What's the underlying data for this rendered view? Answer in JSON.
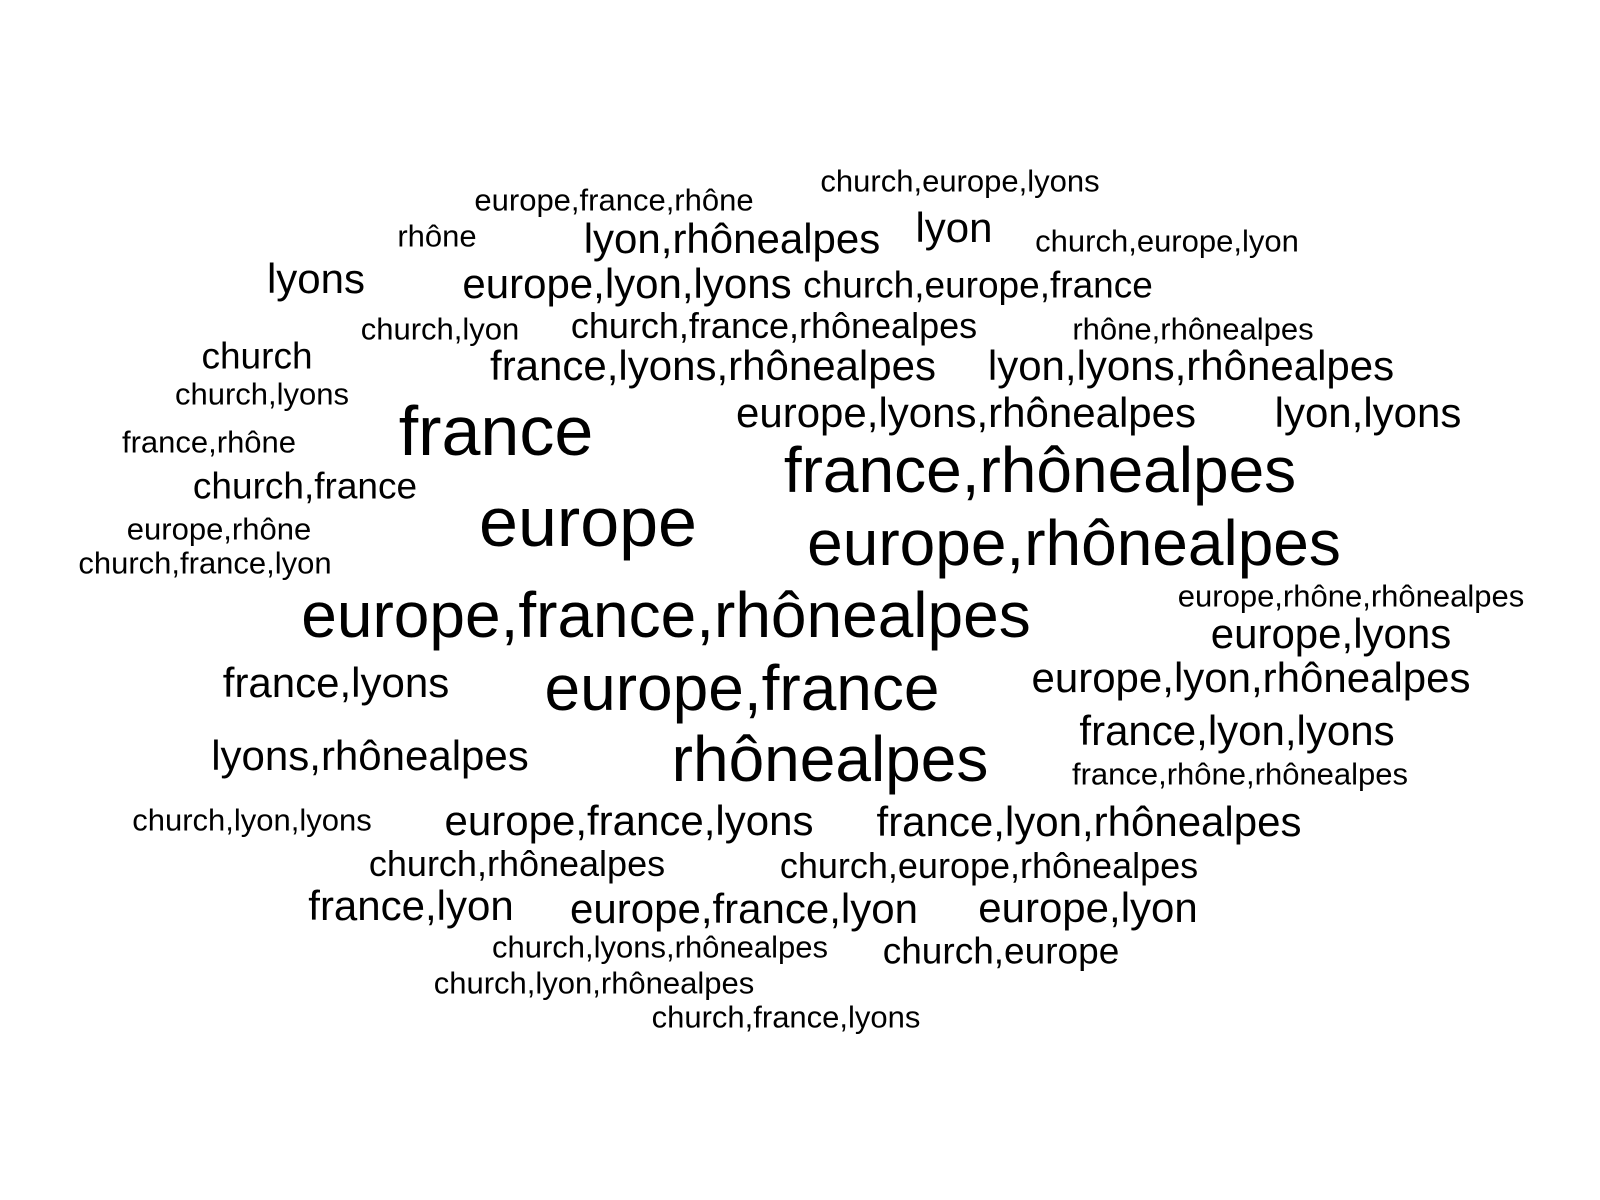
{
  "words": [
    {
      "text": "church,europe,lyons",
      "weight": 1
    },
    {
      "text": "europe,france,rhône",
      "weight": 1
    },
    {
      "text": "rhône",
      "weight": 1
    },
    {
      "text": "lyon,rhônealpes",
      "weight": 2
    },
    {
      "text": "lyon",
      "weight": 2
    },
    {
      "text": "church,europe,lyon",
      "weight": 1
    },
    {
      "text": "lyons",
      "weight": 2
    },
    {
      "text": "europe,lyon,lyons",
      "weight": 2
    },
    {
      "text": "church,europe,france",
      "weight": 2
    },
    {
      "text": "church,lyon",
      "weight": 1
    },
    {
      "text": "church,france,rhônealpes",
      "weight": 1.5
    },
    {
      "text": "rhône,rhônealpes",
      "weight": 1
    },
    {
      "text": "church",
      "weight": 1.5
    },
    {
      "text": "france,lyons,rhônealpes",
      "weight": 2
    },
    {
      "text": "lyon,lyons,rhônealpes",
      "weight": 2
    },
    {
      "text": "church,lyons",
      "weight": 1
    },
    {
      "text": "france",
      "weight": 5
    },
    {
      "text": "europe,lyons,rhônealpes",
      "weight": 2
    },
    {
      "text": "lyon,lyons",
      "weight": 2
    },
    {
      "text": "france,rhône",
      "weight": 1
    },
    {
      "text": "france,rhônealpes",
      "weight": 4
    },
    {
      "text": "church,france",
      "weight": 1.5
    },
    {
      "text": "europe",
      "weight": 5
    },
    {
      "text": "europe,rhônealpes",
      "weight": 4
    },
    {
      "text": "europe,rhône",
      "weight": 1
    },
    {
      "text": "church,france,lyon",
      "weight": 1
    },
    {
      "text": "europe,france,rhônealpes",
      "weight": 4
    },
    {
      "text": "europe,rhône,rhônealpes",
      "weight": 1
    },
    {
      "text": "europe,lyons",
      "weight": 2
    },
    {
      "text": "france,lyons",
      "weight": 2
    },
    {
      "text": "europe,france",
      "weight": 4
    },
    {
      "text": "europe,lyon,rhônealpes",
      "weight": 2
    },
    {
      "text": "france,lyon,lyons",
      "weight": 2
    },
    {
      "text": "lyons,rhônealpes",
      "weight": 2
    },
    {
      "text": "rhônealpes",
      "weight": 4
    },
    {
      "text": "france,rhône,rhônealpes",
      "weight": 1
    },
    {
      "text": "church,lyon,lyons",
      "weight": 1
    },
    {
      "text": "europe,france,lyons",
      "weight": 2
    },
    {
      "text": "france,lyon,rhônealpes",
      "weight": 2
    },
    {
      "text": "church,rhônealpes",
      "weight": 1.5
    },
    {
      "text": "church,europe,rhônealpes",
      "weight": 1.5
    },
    {
      "text": "france,lyon",
      "weight": 2
    },
    {
      "text": "europe,france,lyon",
      "weight": 2
    },
    {
      "text": "europe,lyon",
      "weight": 2
    },
    {
      "text": "church,lyons,rhônealpes",
      "weight": 1
    },
    {
      "text": "church,europe",
      "weight": 1.5
    },
    {
      "text": "church,lyon,rhônealpes",
      "weight": 1
    },
    {
      "text": "church,france,lyons",
      "weight": 1
    }
  ]
}
